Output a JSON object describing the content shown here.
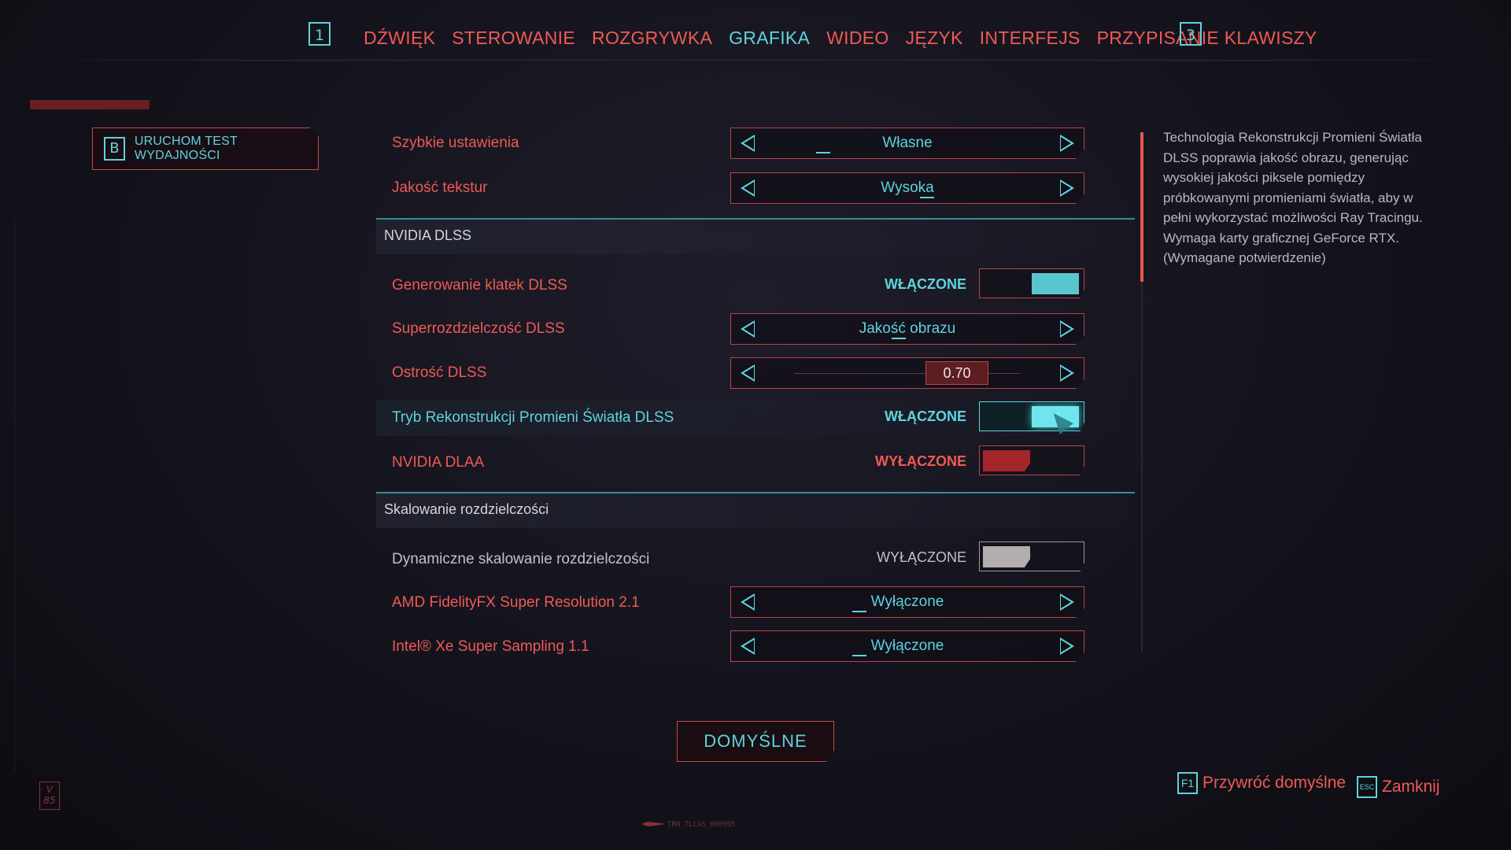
{
  "nav": {
    "prev_key": "1",
    "next_key": "3",
    "tabs": [
      {
        "label": "DŹWIĘK",
        "active": false
      },
      {
        "label": "STEROWANIE",
        "active": false
      },
      {
        "label": "ROZGRYWKA",
        "active": false
      },
      {
        "label": "GRAFIKA",
        "active": true
      },
      {
        "label": "WIDEO",
        "active": false
      },
      {
        "label": "JĘZYK",
        "active": false
      },
      {
        "label": "INTERFEJS",
        "active": false
      },
      {
        "label": "PRZYPISANIE KLAWISZY",
        "active": false
      }
    ]
  },
  "benchmark": {
    "key": "B",
    "label": "URUCHOM TEST WYDAJNOŚCI"
  },
  "settings": {
    "quick_settings": {
      "label": "Szybkie ustawienia",
      "value": "Własne"
    },
    "texture_quality": {
      "label": "Jakość tekstur",
      "value": "Wysoka"
    },
    "dlss_section": "NVIDIA DLSS",
    "frame_gen": {
      "label": "Generowanie klatek DLSS",
      "state": "WŁĄCZONE"
    },
    "super_res": {
      "label": "Superrozdzielczość DLSS",
      "value": "Jakość obrazu"
    },
    "sharpness": {
      "label": "Ostrość DLSS",
      "value": "0.70",
      "level": 0.7
    },
    "ray_recon": {
      "label": "Tryb Rekonstrukcji Promieni Światła DLSS",
      "state": "WŁĄCZONE"
    },
    "dlaa": {
      "label": "NVIDIA DLAA",
      "state": "WYŁĄCZONE"
    },
    "scaling_section": "Skalowanie rozdzielczości",
    "dynamic_scaling": {
      "label": "Dynamiczne skalowanie rozdzielczości",
      "state": "WYŁĄCZONE"
    },
    "fsr": {
      "label": "AMD FidelityFX Super Resolution 2.1",
      "value": "Wyłączone"
    },
    "xess": {
      "label": "Intel® Xe Super Sampling 1.1",
      "value": "Wyłączone"
    }
  },
  "description": "Technologia Rekonstrukcji Promieni Światła\nDLSS poprawia jakość obrazu, generując\nwysokiej jakości piksele pomiędzy\npróbkowanymi promieniami światła, aby w\npełni wykorzystać możliwości Ray Tracingu.\nWymaga karty graficznej GeForce RTX.\n(Wymagane potwierdzenie)",
  "footer": {
    "defaults_button": "DOMYŚLNE",
    "restore": {
      "key": "F1",
      "label": "Przywróć domyślne"
    },
    "close": {
      "key": "ESC",
      "label": "Zamknij"
    },
    "version_badge": "V\n85",
    "code": "TRN_TLCAS_000095"
  },
  "colors": {
    "accent_cyan": "#5ed3dd",
    "accent_red": "#ee5a55",
    "background": "#14131c"
  }
}
